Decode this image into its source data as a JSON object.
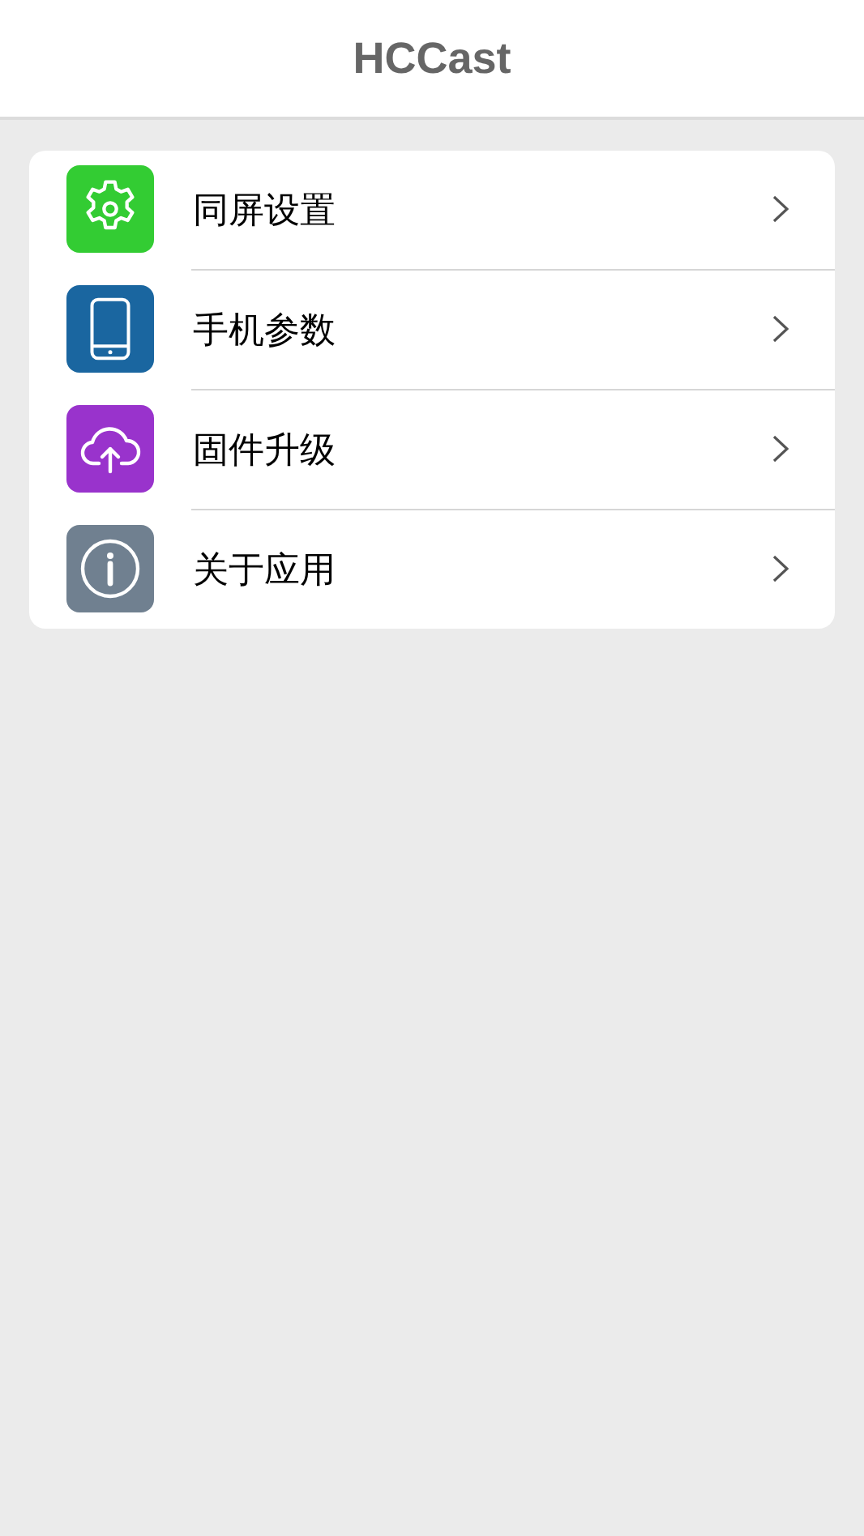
{
  "header": {
    "title": "HCCast"
  },
  "menu": {
    "items": [
      {
        "label": "同屏设置",
        "kind": "gear",
        "color": "#33cc33"
      },
      {
        "label": "手机参数",
        "kind": "phone",
        "color": "#1a66a0"
      },
      {
        "label": "固件升级",
        "kind": "cloud",
        "color": "#9933cc"
      },
      {
        "label": "关于应用",
        "kind": "info",
        "color": "#708090"
      }
    ]
  }
}
